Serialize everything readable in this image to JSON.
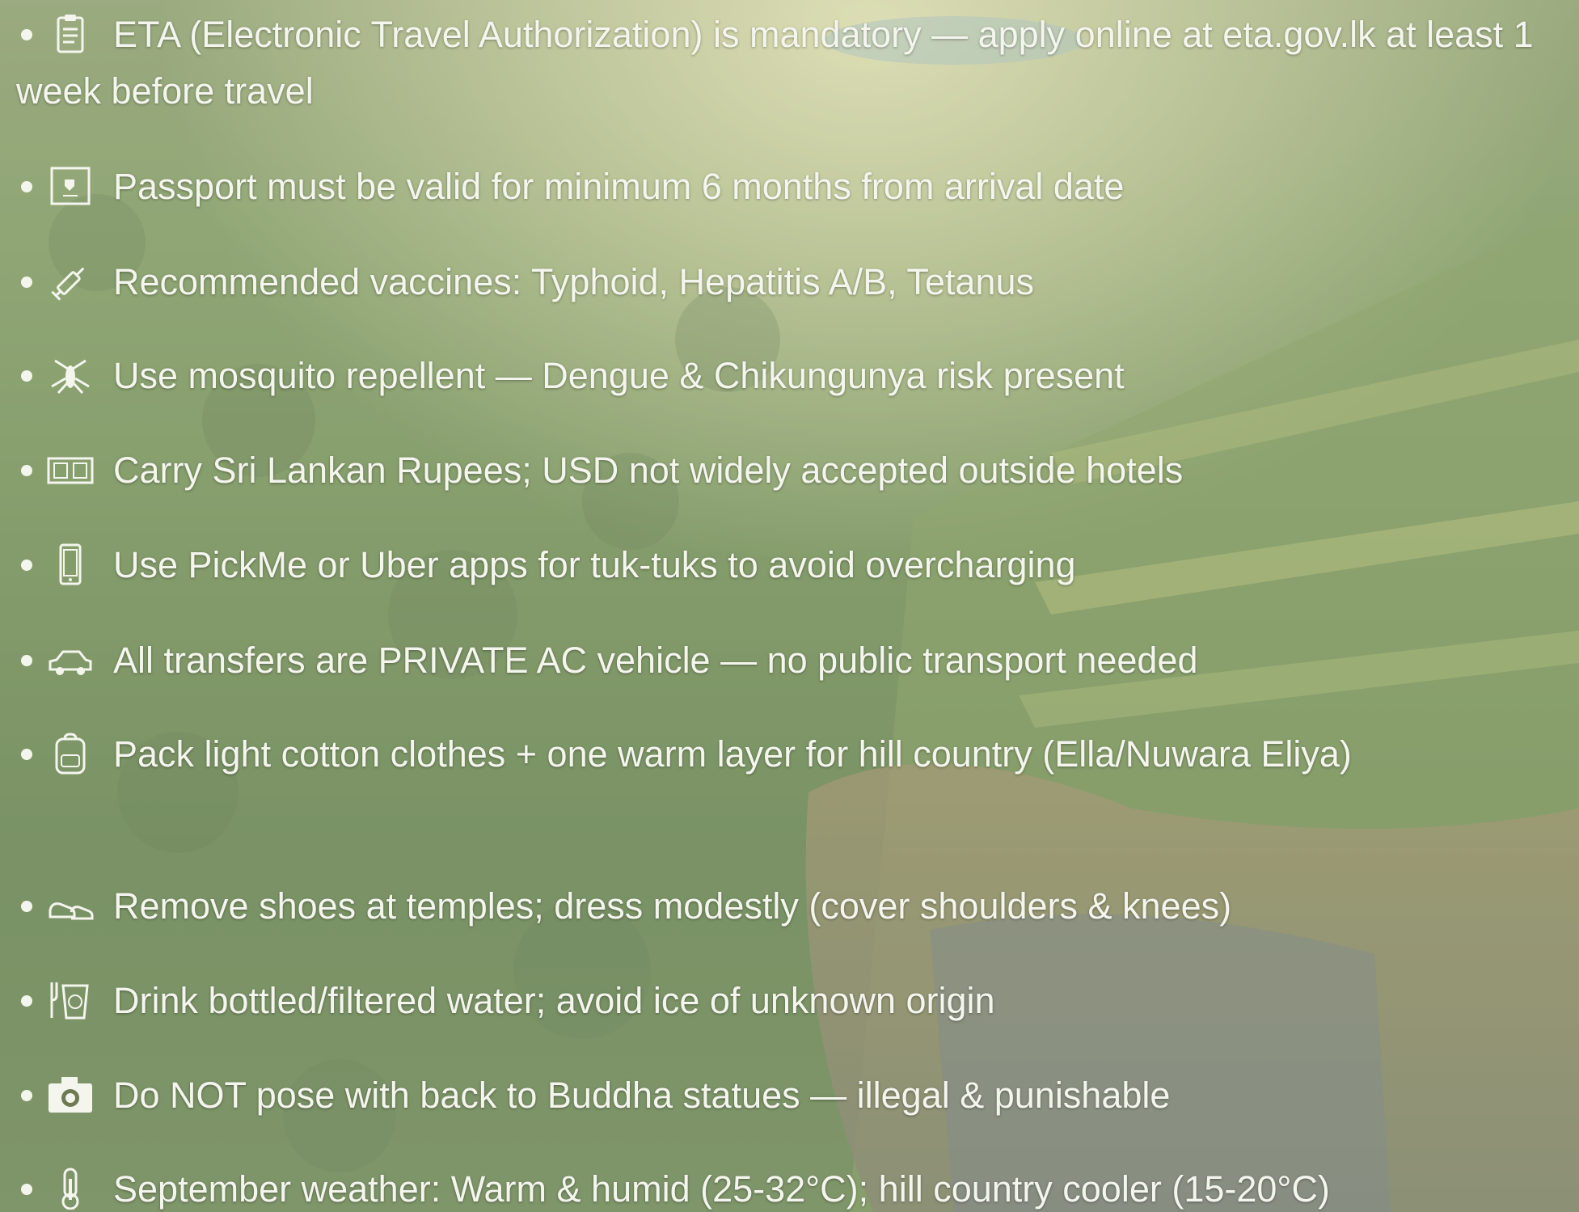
{
  "tips": [
    {
      "icon": "clipboard-icon",
      "text": "ETA (Electronic Travel Authorization) is mandatory — apply online at eta.gov.lk at least 1 week before travel"
    },
    {
      "icon": "passport-icon",
      "text": "Passport must be valid for minimum 6 months from arrival date"
    },
    {
      "icon": "syringe-icon",
      "text": "Recommended vaccines: Typhoid, Hepatitis A/B, Tetanus"
    },
    {
      "icon": "mosquito-icon",
      "text": "Use mosquito repellent — Dengue & Chikungunya risk present"
    },
    {
      "icon": "currency-icon",
      "text": "Carry Sri Lankan Rupees; USD not widely accepted outside hotels"
    },
    {
      "icon": "mobile-phone-icon",
      "text": "Use PickMe or Uber apps for tuk-tuks to avoid overcharging"
    },
    {
      "icon": "car-icon",
      "text": "All transfers are PRIVATE AC vehicle — no public transport needed"
    },
    {
      "icon": "backpack-icon",
      "text": "Pack light cotton clothes + one warm layer for hill country (Ella/Nuwara Eliya)"
    },
    {
      "icon": "shoes-icon",
      "text": "Remove shoes at temples; dress modestly (cover shoulders & knees)"
    },
    {
      "icon": "water-glass-icon",
      "text": "Drink bottled/filtered water; avoid ice of unknown origin"
    },
    {
      "icon": "camera-icon",
      "text": "Do NOT pose with back to Buddha statues — illegal & punishable"
    },
    {
      "icon": "thermometer-icon",
      "text": "September weather: Warm & humid (25-32°C); hill country cooler (15-20°C)"
    }
  ]
}
